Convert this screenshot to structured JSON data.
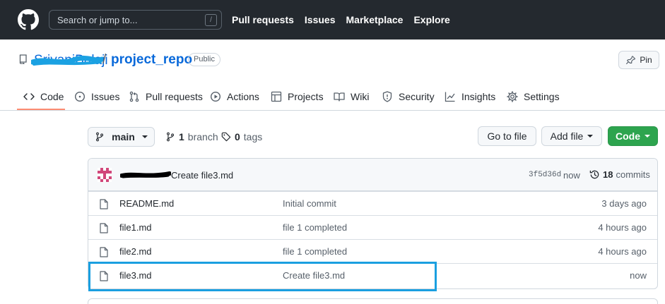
{
  "header": {
    "search_placeholder": "Search or jump to...",
    "search_key": "/",
    "nav": [
      "Pull requests",
      "Issues",
      "Marketplace",
      "Explore"
    ]
  },
  "repo": {
    "owner": "SrivaniBalaji",
    "separator": "/",
    "name": "project_repo",
    "visibility": "Public",
    "pin_label": "Pin"
  },
  "tabs": [
    {
      "label": "Code",
      "icon": "code-icon",
      "active": true
    },
    {
      "label": "Issues",
      "icon": "issue-icon"
    },
    {
      "label": "Pull requests",
      "icon": "pull-request-icon"
    },
    {
      "label": "Actions",
      "icon": "play-icon"
    },
    {
      "label": "Projects",
      "icon": "table-icon"
    },
    {
      "label": "Wiki",
      "icon": "book-icon"
    },
    {
      "label": "Security",
      "icon": "shield-icon"
    },
    {
      "label": "Insights",
      "icon": "graph-icon"
    },
    {
      "label": "Settings",
      "icon": "gear-icon"
    }
  ],
  "toolbar": {
    "branch": "main",
    "branch_count": "1",
    "branch_word": "branch",
    "tag_count": "0",
    "tag_word": "tags",
    "go_to_file": "Go to file",
    "add_file": "Add file",
    "code": "Code"
  },
  "latest_commit": {
    "message": "Create file3.md",
    "sha": "3f5d36d",
    "time": "now",
    "commit_count": "18",
    "commit_word": "commits"
  },
  "files": [
    {
      "name": "README.md",
      "message": "Initial commit",
      "age": "3 days ago"
    },
    {
      "name": "file1.md",
      "message": "file 1 completed",
      "age": "4 hours ago"
    },
    {
      "name": "file2.md",
      "message": "file 1 completed",
      "age": "4 hours ago"
    },
    {
      "name": "file3.md",
      "message": "Create file3.md",
      "age": "now"
    }
  ],
  "colors": {
    "header_bg": "#24292f",
    "link": "#0969da",
    "code_button": "#2da44e",
    "active_tab": "#fd8c73",
    "annotation_box": "#1a9fe0"
  }
}
